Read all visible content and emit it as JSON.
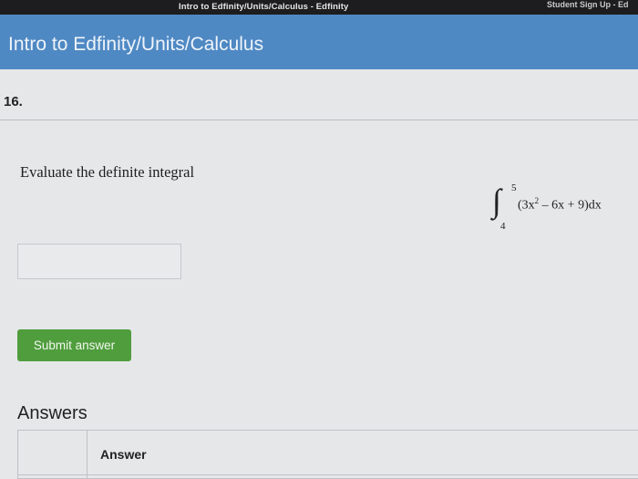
{
  "browser": {
    "tab_title": "Intro to Edfinity/Units/Calculus - Edfinity",
    "right_text": "Student Sign Up - Ed"
  },
  "header": {
    "title": "Intro to Edfinity/Units/Calculus"
  },
  "question": {
    "number": "16.",
    "prompt": "Evaluate the definite integral",
    "integral": {
      "upper": "5",
      "lower": "4",
      "expression_parts": [
        "(3x",
        "2",
        " – 6x + 9)dx"
      ]
    }
  },
  "answer_field": {
    "value": "",
    "icon": "pencil-icon"
  },
  "submit_label": "Submit answer",
  "answers": {
    "heading": "Answers",
    "column_header": "Answer"
  },
  "colors": {
    "header_bg": "#4f89c4",
    "submit_bg": "#4f9d3d"
  }
}
